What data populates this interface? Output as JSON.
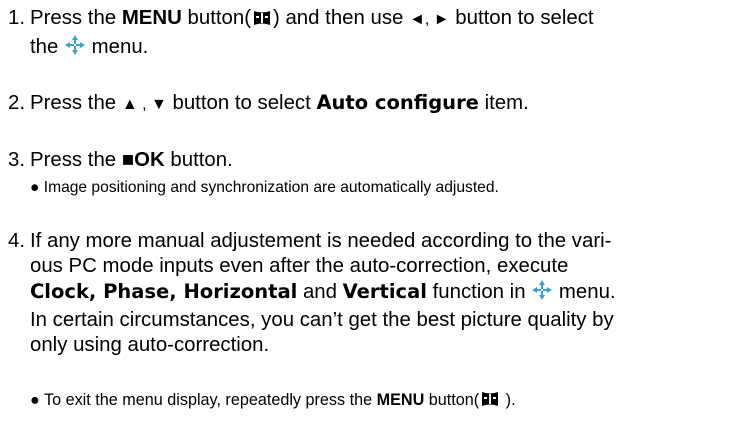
{
  "step1": {
    "num": "1.",
    "a": "Press the ",
    "menu": "MENU",
    "b": " button(",
    "c": ") and then use ",
    "arrows": "◄, ►",
    "d": " button to select",
    "e": "the ",
    "f": " menu.",
    "menu_icon": "menu-button-icon",
    "nav_icon": "four-way-arrow-icon"
  },
  "step2": {
    "num": "2.",
    "a": "Press the ",
    "arrows": "▲ , ▼",
    "b": " button to select ",
    "item": "Auto configure",
    "c": " item."
  },
  "step3": {
    "num": "3.",
    "a": "Press the ",
    "ok_square": "■",
    "ok": "OK",
    "b": " button.",
    "bullet": "● Image positioning and synchronization are automatically adjusted."
  },
  "step4": {
    "num": "4.",
    "line1": "If any more manual adjustement is needed according to the vari-",
    "line2": "ous PC mode inputs even after the auto-correction, execute",
    "clock": "Clock, Phase, Horizontal",
    "and": " and ",
    "vertical": "Vertical",
    "fn": " function in ",
    "menu_end": " menu.",
    "line4": "In certain circumstances, you can’t get the best picture quality by",
    "line5": "only using auto-correction."
  },
  "exit": {
    "a": "● To exit the menu display, repeatedly press the ",
    "menu": "MENU",
    "b": " button(",
    "c": " )."
  },
  "colors": {
    "text": "#000000",
    "arrow_icon": "#3aa0d8"
  }
}
